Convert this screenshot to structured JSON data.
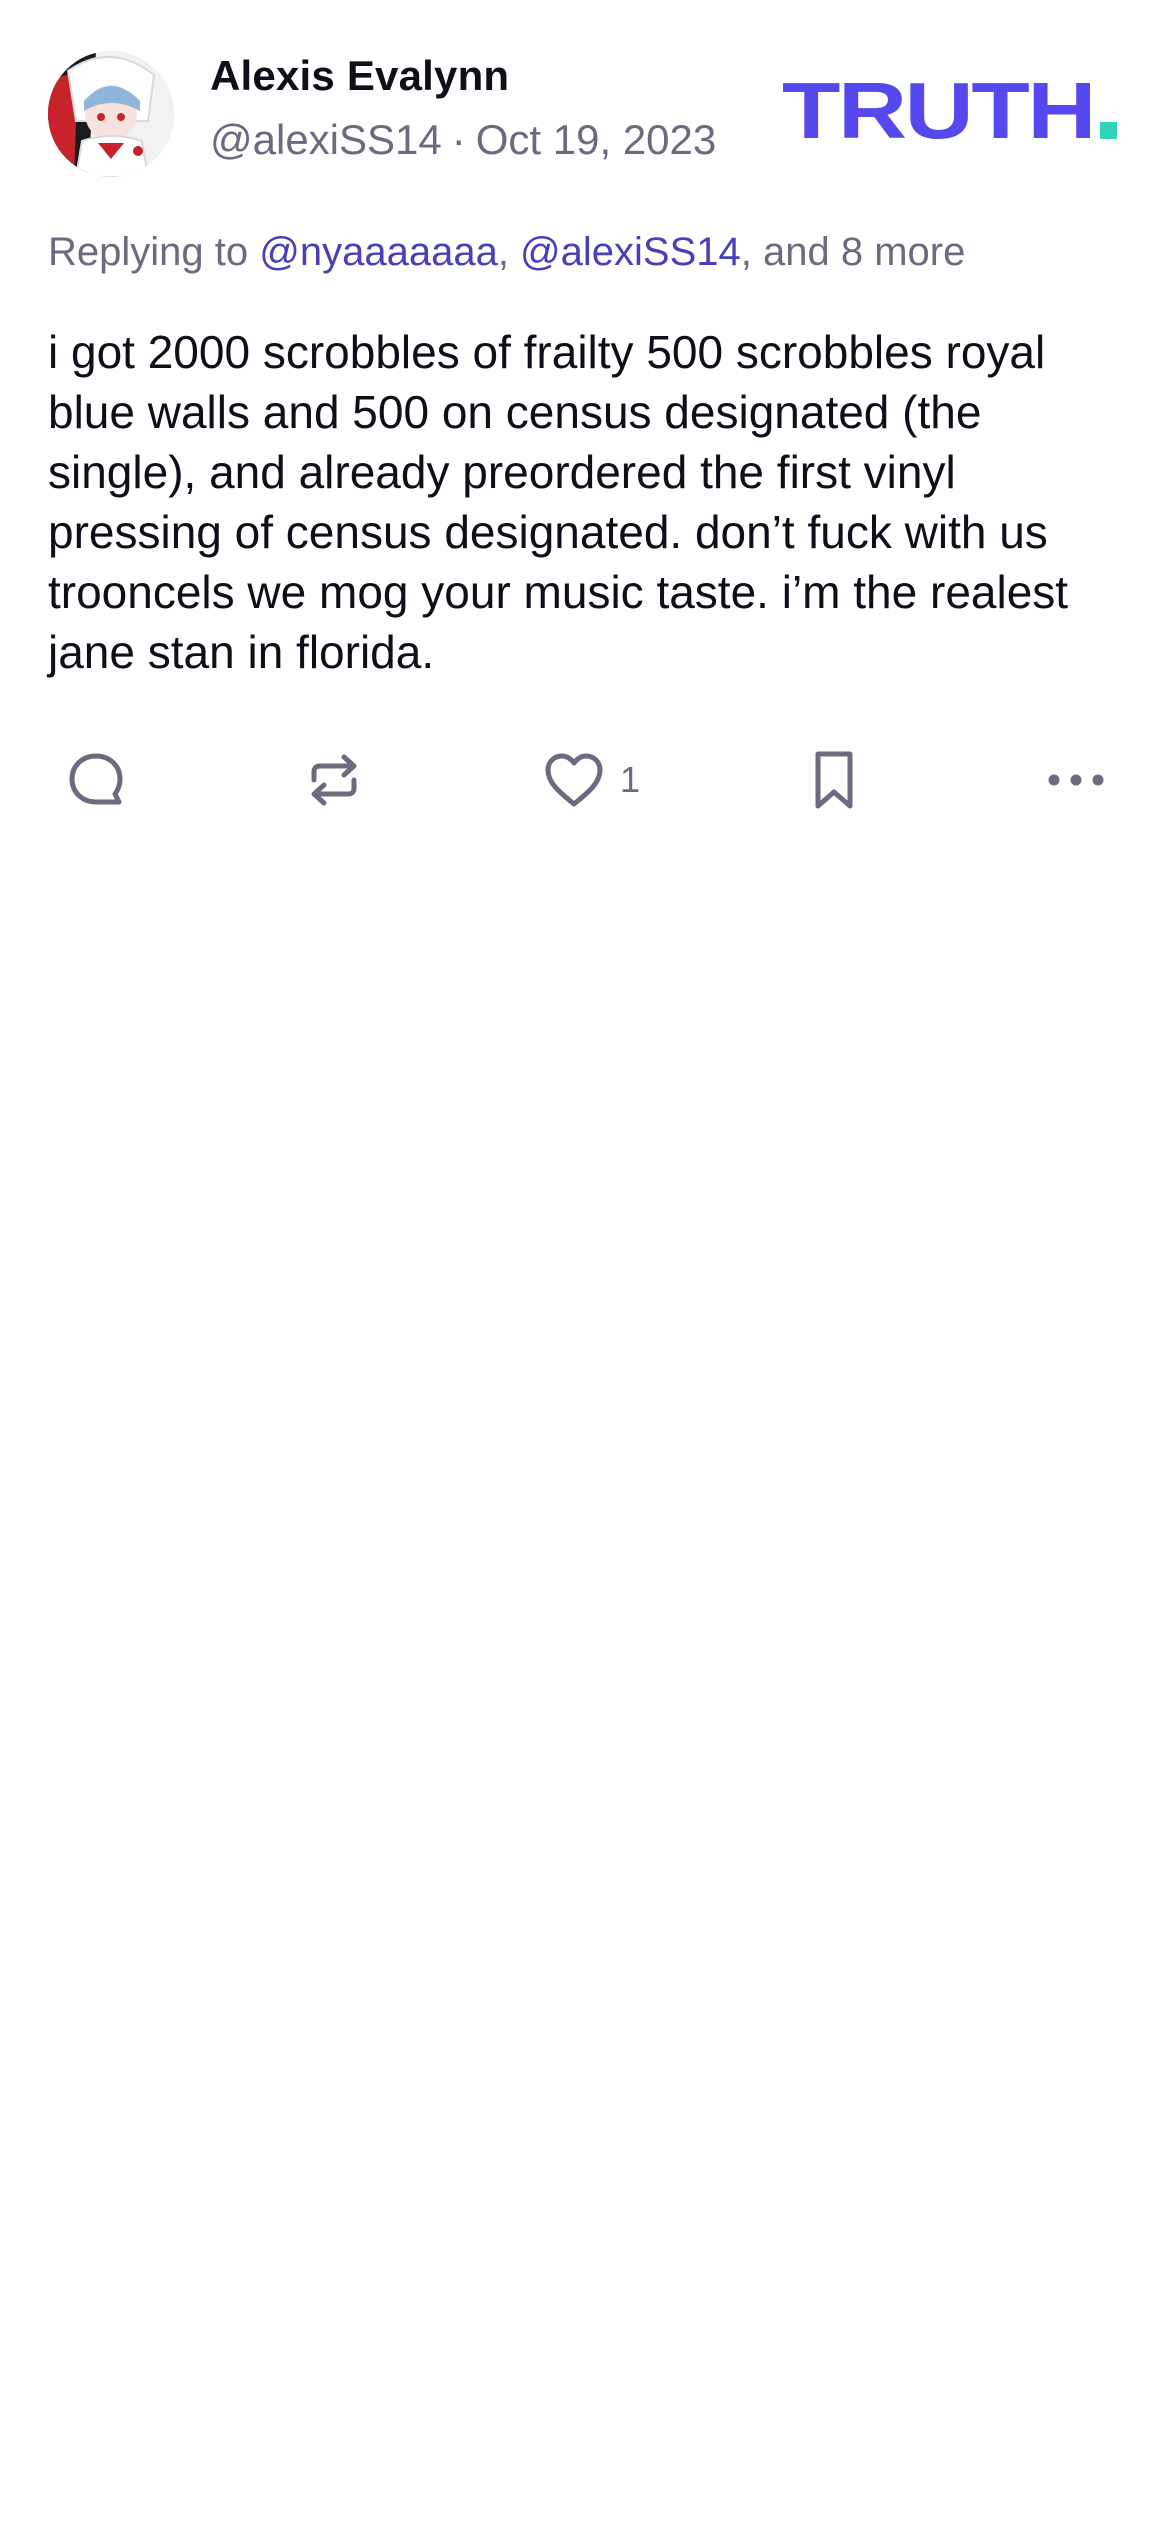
{
  "post": {
    "author": {
      "display_name": "Alexis Evalynn",
      "handle": "@alexiSS14",
      "date": "Oct 19, 2023",
      "separator": "·"
    },
    "logo": {
      "text": "TRUTH",
      "text_color": "#5448ee",
      "dot_color": "#2fd4b8"
    },
    "reply": {
      "prefix": "Replying to ",
      "mentions": [
        "@nyaaaaaaa",
        "@alexiSS14"
      ],
      "comma": ", ",
      "suffix": ", and 8 more"
    },
    "text": "i got 2000 scrobbles of frailty 500 scrobbles royal blue walls and 500 on census designated (the single), and already preordered the first vinyl pressing of census designated. don’t fuck with us trooncels we mog your music taste. i’m the realest jane stan in florida.",
    "actions": {
      "reply_icon": "comment-icon",
      "retruth_icon": "repost-icon",
      "like_icon": "heart-icon",
      "like_count": "1",
      "bookmark_icon": "bookmark-icon",
      "more_icon": "more-icon"
    }
  },
  "colors": {
    "text_primary": "#0f0f1a",
    "text_secondary": "#6b6b80",
    "mention": "#4a3fb8",
    "icon": "#6b6b80"
  }
}
